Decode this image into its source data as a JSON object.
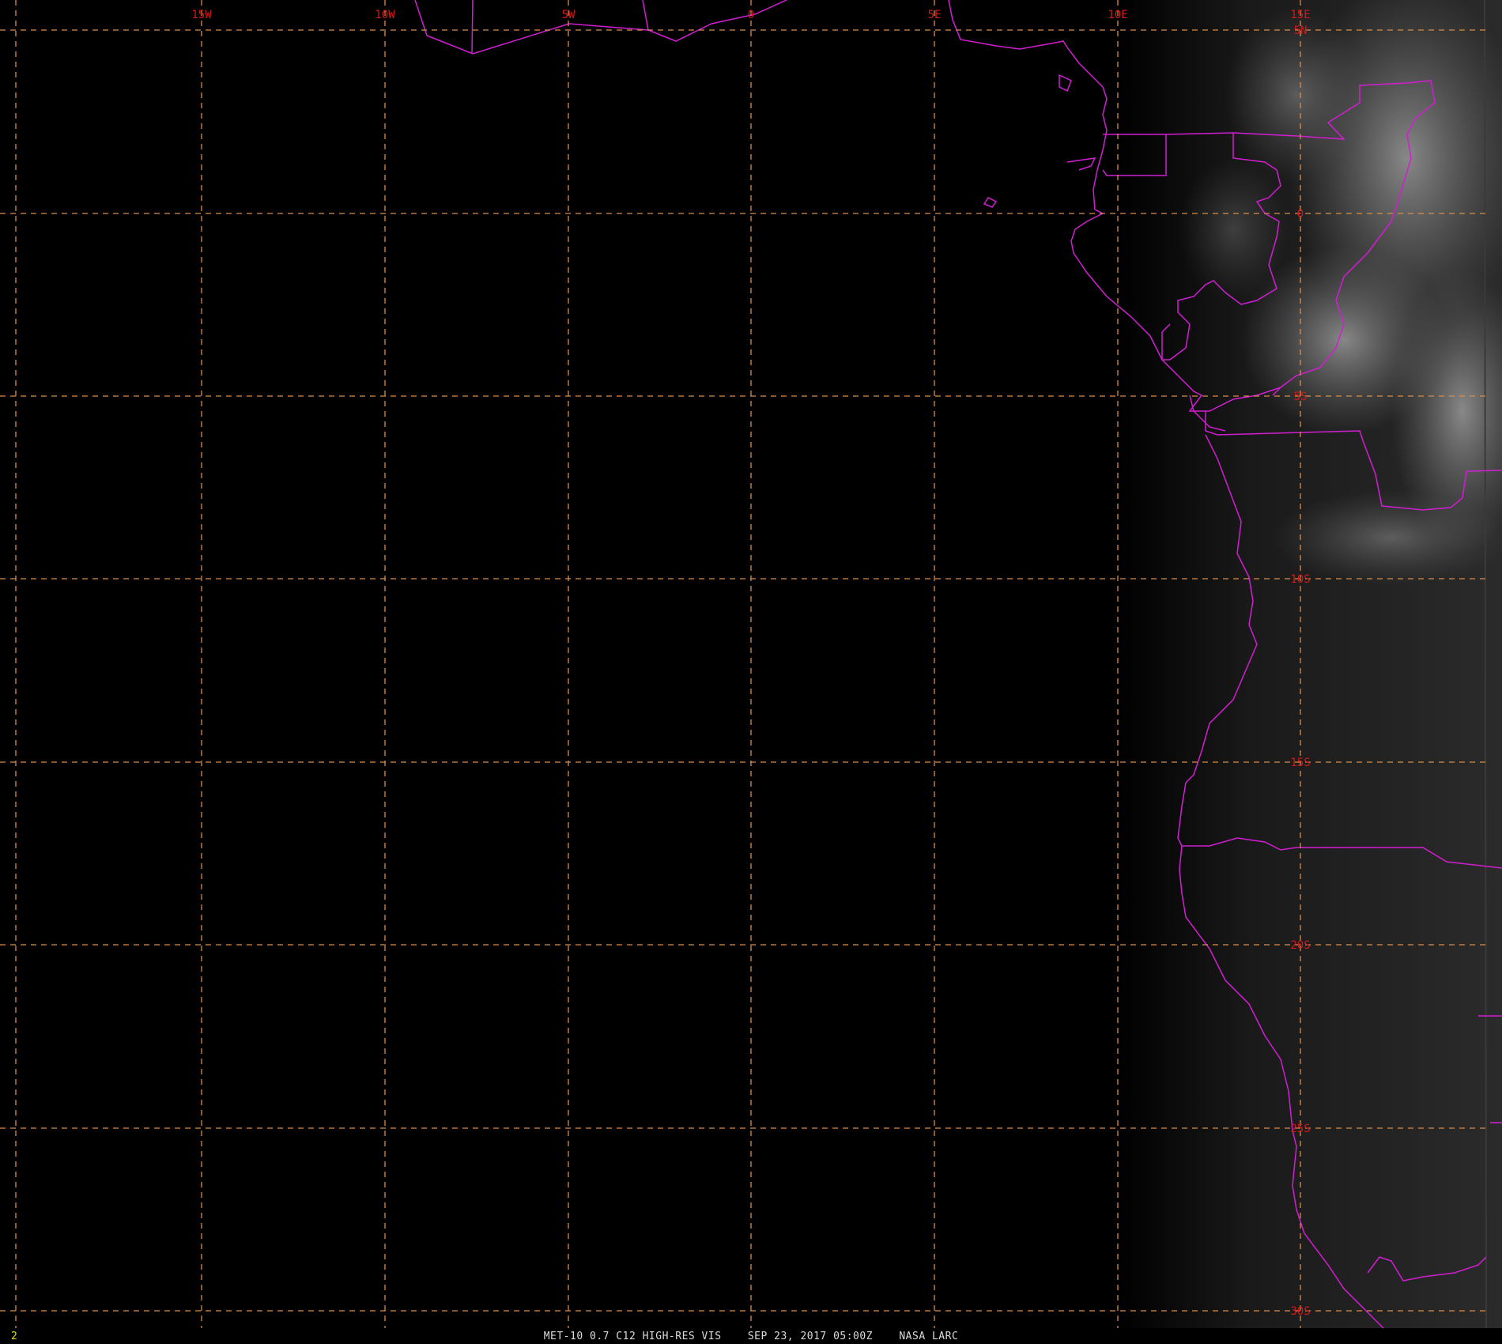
{
  "frame_number": "2",
  "caption": "MET-10 0.7 C12 HIGH-RES VIS    SEP 23, 2017 05:00Z    NASA LARC",
  "colors": {
    "background": "#000000",
    "gridline": "#d98c4a",
    "grid_label": "#d11a1a",
    "boundaries": "#d21ed2",
    "frame_number": "#e6e600",
    "caption": "#dcdcdc"
  },
  "grid": {
    "longitude_labels": [
      "15W",
      "10W",
      "5W",
      "0",
      "5E",
      "10E",
      "15E"
    ],
    "latitude_labels": [
      "5N",
      "0",
      "5S",
      "10S",
      "15S",
      "20S",
      "25S",
      "30S"
    ]
  }
}
